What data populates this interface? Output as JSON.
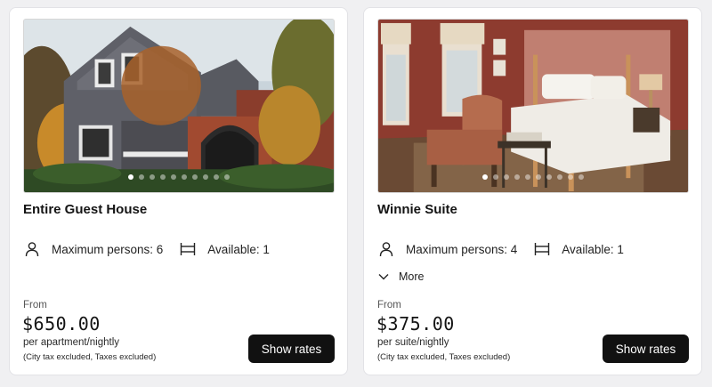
{
  "cards": [
    {
      "title": "Entire Guest House",
      "max_persons": "Maximum persons: 6",
      "available": "Available: 1",
      "from_label": "From",
      "price": "$650.00",
      "per_label": "per apartment/nightly",
      "tax_note": "(City tax excluded, Taxes excluded)",
      "button_label": "Show rates",
      "image_dots": 10,
      "active_dot": 1
    },
    {
      "title": "Winnie Suite",
      "max_persons": "Maximum persons: 4",
      "available": "Available: 1",
      "more_label": "More",
      "from_label": "From",
      "price": "$375.00",
      "per_label": "per suite/nightly",
      "tax_note": "(City tax excluded, Taxes excluded)",
      "button_label": "Show rates",
      "image_dots": 10,
      "active_dot": 1
    }
  ],
  "icons": {
    "persons": "person-icon",
    "availability": "bed-icon",
    "more": "chevron-down-icon"
  },
  "colors": {
    "background": "#f0f0f2",
    "button": "#111111",
    "button_text": "#ffffff"
  }
}
